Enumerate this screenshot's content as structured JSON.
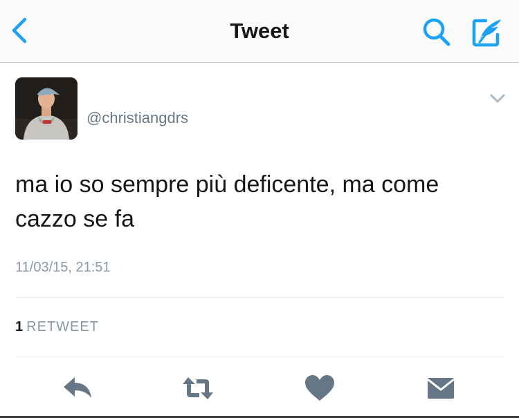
{
  "nav": {
    "title": "Tweet",
    "back_icon": "chevron-left-icon",
    "search_icon": "search-icon",
    "compose_icon": "compose-tweet-icon",
    "accent_color": "#1da1f2"
  },
  "tweet": {
    "handle": "@christiangdrs",
    "text": "ma io so sempre più deficente, ma come cazzo se fa",
    "timestamp": "11/03/15, 21:51",
    "retweets": {
      "count": "1",
      "label": "RETWEET"
    }
  },
  "actions": [
    {
      "name": "reply-icon"
    },
    {
      "name": "retweet-icon"
    },
    {
      "name": "like-icon"
    },
    {
      "name": "direct-message-icon"
    }
  ],
  "colors": {
    "text": "#14171a",
    "secondary": "#657786",
    "muted": "#8899a6",
    "action_icons": "#657786"
  }
}
